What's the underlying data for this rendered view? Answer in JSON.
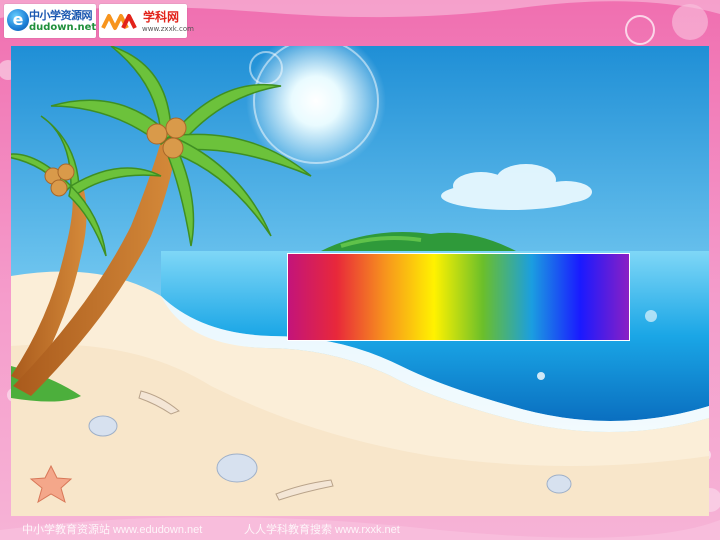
{
  "header": {
    "logo_primary": {
      "mark": "e",
      "title": "中小学资源网",
      "subtitle": "dudown.net"
    },
    "logo_secondary": {
      "title": "学科网",
      "subtitle": "www.zxxk.com"
    }
  },
  "slide": {
    "spectrum_colors": [
      "#c3147a",
      "#e8283a",
      "#f7941d",
      "#fff200",
      "#6bbf2a",
      "#1b9ee0",
      "#1a1aff",
      "#8a1fc4"
    ]
  },
  "footer": {
    "left_text": "中小学教育资源站 www.edudown.net",
    "right_text": "人人学科教育搜索 www.rxxk.net"
  },
  "colors": {
    "frame_pink": "#f06fb0",
    "sky_top": "#1f8fd6",
    "sea": "#1aa6e6",
    "sand": "#fbeed8"
  }
}
